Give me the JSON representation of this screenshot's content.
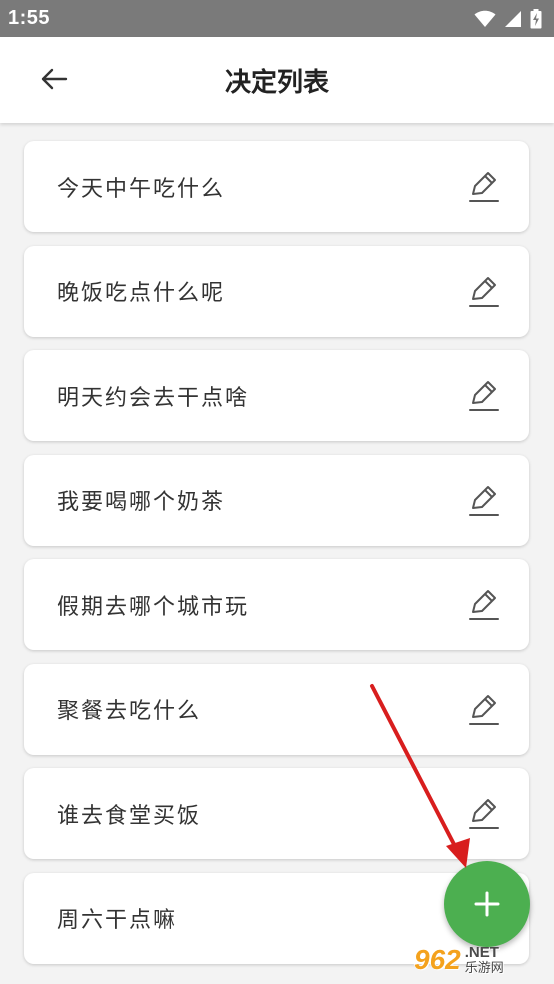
{
  "status_bar": {
    "time": "1:55",
    "icons": [
      "wifi-icon",
      "cell-signal-icon",
      "battery-charging-icon"
    ]
  },
  "header": {
    "title": "决定列表",
    "back_icon": "arrow-left-icon"
  },
  "decisions": [
    {
      "label": "今天中午吃什么"
    },
    {
      "label": "晚饭吃点什么呢"
    },
    {
      "label": "明天约会去干点啥"
    },
    {
      "label": "我要喝哪个奶茶"
    },
    {
      "label": "假期去哪个城市玩"
    },
    {
      "label": "聚餐去吃什么"
    },
    {
      "label": "谁去食堂买饭"
    },
    {
      "label": "周六干点嘛"
    }
  ],
  "fab": {
    "icon": "plus-icon",
    "color": "#4caf50"
  },
  "annotation": {
    "arrow_color": "#e02020"
  },
  "watermark": {
    "brand": "962",
    "domain": ".NET",
    "site_name": "乐游网"
  },
  "colors": {
    "status_bar": "#7a7a7a",
    "app_bar": "#ffffff",
    "background": "#f3f3f3",
    "card": "#ffffff",
    "text": "#333333"
  }
}
